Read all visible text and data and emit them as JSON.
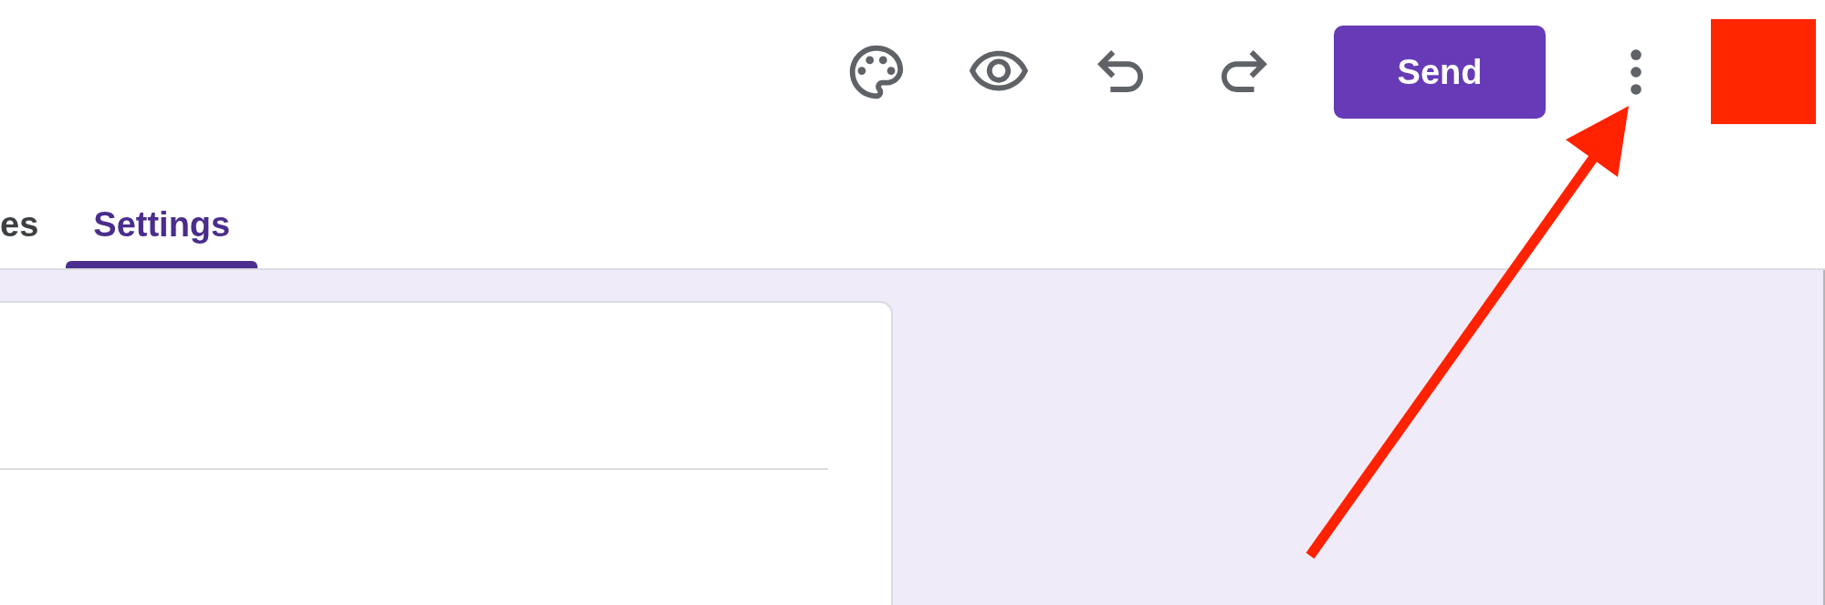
{
  "toolbar": {
    "send_button": {
      "label": "Send"
    }
  },
  "tabs": [
    {
      "label": "es",
      "selected": false
    },
    {
      "label": "Settings",
      "selected": true
    }
  ]
}
